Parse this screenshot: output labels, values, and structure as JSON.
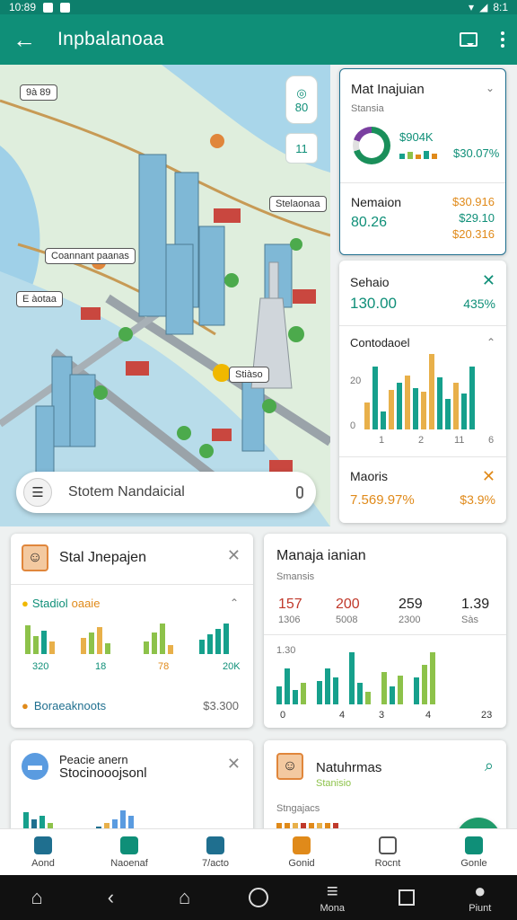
{
  "status_bar": {
    "time": "10:89",
    "battery": "8:1"
  },
  "app_bar": {
    "title": "Inpbalanoaa"
  },
  "map": {
    "labels": [
      "9à 89",
      "Stelaonaa",
      "Coannant paanas",
      "E àotaa",
      "Stiàso"
    ],
    "controls": [
      "80",
      "11"
    ],
    "search_placeholder": "Stotem Nandaicial"
  },
  "cards": {
    "mat": {
      "title": "Mat Inajuian",
      "subtitle": "Stansia",
      "value": "$904K",
      "change": "$30.07%"
    },
    "nemaion": {
      "label": "Nemaion",
      "value": "80.26",
      "v1": "$30.916",
      "v2": "$29.10",
      "v3": "$20.316"
    },
    "sehaio": {
      "label": "Sehaio",
      "value": "130.00",
      "change": "435%"
    },
    "contraded": {
      "label": "Contodaoel",
      "y_tick": "20",
      "y_zero": "0",
      "x_ticks": [
        "1",
        "2",
        "11",
        "6"
      ]
    },
    "maoris": {
      "label": "Maoris",
      "value": "7.569.97%",
      "change": "$3.9%"
    },
    "stal": {
      "title": "Stal Jnepajen",
      "sub_label": "Stadiol",
      "sub_label_orange": "oaaie",
      "x_labels": [
        "320",
        "18",
        "78",
        "20K"
      ],
      "footer_label": "Boraeaknoots",
      "footer_value": "$3.300"
    },
    "manaja": {
      "title": "Manaja ianian",
      "subtitle": "Smansis",
      "stats": [
        {
          "value": "157",
          "label": "1306"
        },
        {
          "value": "200",
          "label": "5008"
        },
        {
          "value": "259",
          "label": "2300"
        },
        {
          "value": "1.39",
          "label": "Sàs"
        }
      ],
      "y_tick": "1.30",
      "x_ticks": [
        "0",
        "4",
        "3",
        "4",
        "23"
      ]
    },
    "people": {
      "title": "Peacie anern",
      "subtitle": "Stocinooojsonl"
    },
    "natuhrmas": {
      "title": "Natuhrmas",
      "subtitle": "Stanisio",
      "subtitle2": "Stngajacs"
    }
  },
  "bottom_tabs": [
    "Aond",
    "Naoenaf",
    "7/acto",
    "Gonid",
    "Rocnt",
    "Gonle"
  ],
  "system_nav": [
    "",
    "",
    "",
    "",
    "Mona",
    "Piunt"
  ],
  "colors": {
    "primary": "#0f8f78",
    "accent_orange": "#e08a1a",
    "bar_teal": "#16a08c",
    "bar_green": "#8dc24a"
  }
}
